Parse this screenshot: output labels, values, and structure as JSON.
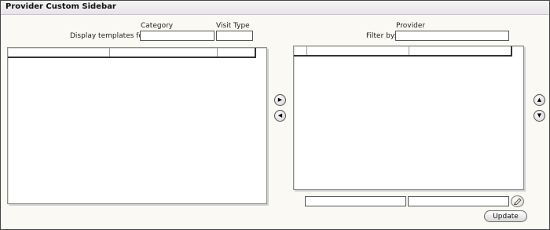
{
  "window": {
    "title": "Provider Custom Sidebar"
  },
  "left_panel": {
    "category_label": "Category",
    "visit_type_label": "Visit Type",
    "display_templates_label": "Display templates for:",
    "category_value": "",
    "visit_type_value": "",
    "grid_columns": [
      "",
      "",
      ""
    ]
  },
  "right_panel": {
    "provider_label": "Provider",
    "filter_label": "Filter by:",
    "provider_value": "",
    "grid_columns": [
      "",
      "",
      ""
    ],
    "bottom_field_1": "",
    "bottom_field_2": ""
  },
  "controls": {
    "move_right": "▶",
    "move_left": "◀",
    "move_up": "▲",
    "move_down": "▼",
    "edit_icon": "pencil-icon",
    "update_label": "Update"
  }
}
